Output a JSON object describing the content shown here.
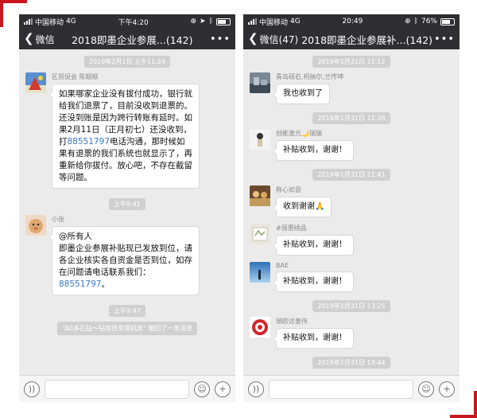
{
  "left": {
    "status": {
      "carrier": "中国移动",
      "network": "4G",
      "time": "下午4:20"
    },
    "nav": {
      "back": "微信",
      "title": "2018即墨企业参展...(142)",
      "more": "•••"
    },
    "messages": [
      {
        "kind": "time",
        "text": "2019年2月1日 上午11:24"
      },
      {
        "kind": "msg",
        "sender": "区贸促会 陈顺顺",
        "parts": [
          "如果哪家企业没有拔付成功，银行就给我们退票了，目前没收到退票的。还没到账是因为跨行转账有延时。如果2月11日（正月初七）还没收到，打",
          "88551797",
          "电话沟通，那时候如果有退票的我们系统也就显示了，再重新给你拔付。放心吧，不存在截留等问题。"
        ]
      },
      {
        "kind": "time",
        "text": "上午9:41"
      },
      {
        "kind": "msg",
        "sender": "小张",
        "parts": [
          "@所有人\n即墨企业参展补贴现已发放到位，请各企业核实各自资金是否到位，如存在问题请电话联系我们：",
          "88551797",
          "。"
        ]
      },
      {
        "kind": "time",
        "text": "上午9:47"
      },
      {
        "kind": "recall",
        "text": "\"A0多孔钻～钻攻铣专用机床\" 撤回了一条消息"
      }
    ]
  },
  "right": {
    "status": {
      "carrier": "中国移动",
      "network": "4G",
      "time": "20:49",
      "battery": "76%"
    },
    "nav": {
      "back": "微信(47)",
      "title": "2018即墨企业参展补...(142)",
      "more": "•••"
    },
    "messages": [
      {
        "kind": "time",
        "text": "2019年1月31日 11:12"
      },
      {
        "kind": "msg",
        "sender": "青岛硕石,柯纳尔,兰传坤",
        "text": "我也收到了"
      },
      {
        "kind": "time",
        "text": "2019年1月31日 11:38"
      },
      {
        "kind": "msg",
        "sender": "创能激光🌙瑞瑞",
        "text": "补贴收到，谢谢！"
      },
      {
        "kind": "time",
        "text": "2019年1月31日 11:41"
      },
      {
        "kind": "msg",
        "sender": "称心如意",
        "text": "收到谢谢🙏"
      },
      {
        "kind": "msg",
        "sender": "#丽惠绣品",
        "text": "补贴收到，谢谢！"
      },
      {
        "kind": "msg",
        "sender": "BAE",
        "text": "补贴收到，谢谢！"
      },
      {
        "kind": "time",
        "text": "2019年1月31日 13:25"
      },
      {
        "kind": "msg",
        "sender": "瑞欧达姜伟",
        "text": "补贴收到，谢谢！"
      },
      {
        "kind": "time",
        "text": "2019年1月31日 13:44"
      }
    ]
  },
  "colors": {
    "accent": "#c9151e",
    "link": "#3a77c8",
    "navbar": "#2e2f33",
    "chat_bg": "#ebebeb"
  },
  "icons": {
    "voice": "voice-icon",
    "emoji": "emoji-icon",
    "plus": "plus-icon"
  }
}
